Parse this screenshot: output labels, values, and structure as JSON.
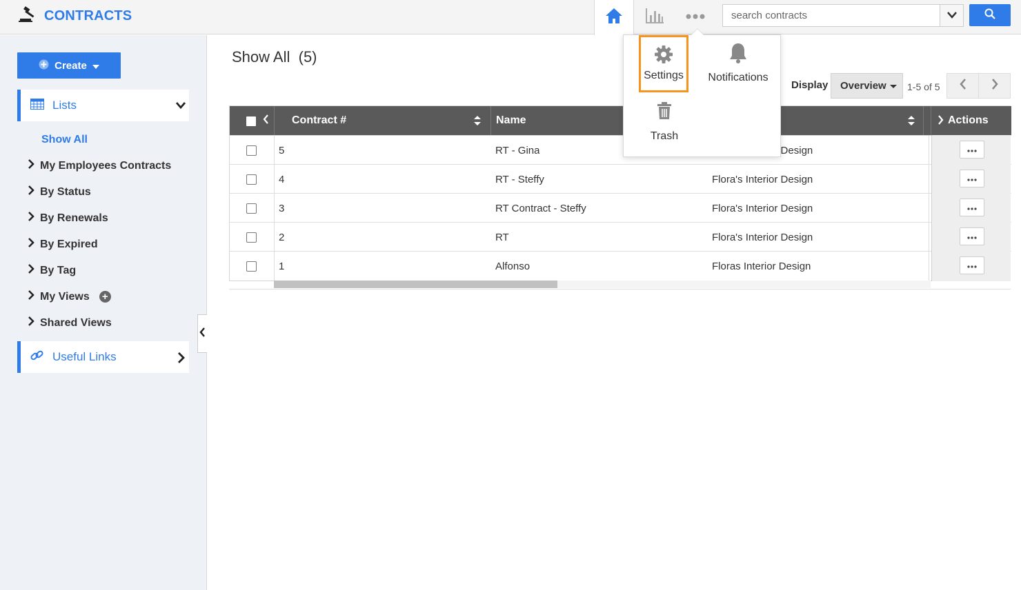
{
  "app": {
    "title": "CONTRACTS"
  },
  "topbar": {
    "icons": [
      "home-icon",
      "chart-icon",
      "more-dots-icon"
    ],
    "search": {
      "placeholder": "search contracts",
      "value": ""
    }
  },
  "sidebar": {
    "create_label": "Create",
    "lists_label": "Lists",
    "active_item": "Show All",
    "items": [
      {
        "label": "My Employees Contracts"
      },
      {
        "label": "By Status"
      },
      {
        "label": "By Renewals"
      },
      {
        "label": "By Expired"
      },
      {
        "label": "By Tag"
      },
      {
        "label": "My Views"
      },
      {
        "label": "Shared Views"
      }
    ],
    "useful_links_label": "Useful Links"
  },
  "main": {
    "title": "Show All",
    "count": "(5)",
    "display_label": "Display",
    "display_value": "Overview",
    "pager_text": "1-5 of 5"
  },
  "table": {
    "columns": [
      "Contract #",
      "Name",
      "Actions"
    ],
    "rows": [
      {
        "contract": "5",
        "name": "RT - Gina",
        "company": "Flora's Interior Design"
      },
      {
        "contract": "4",
        "name": "RT - Steffy",
        "company": "Flora's Interior Design"
      },
      {
        "contract": "3",
        "name": "RT Contract - Steffy",
        "company": "Flora's Interior Design"
      },
      {
        "contract": "2",
        "name": "RT",
        "company": "Flora's Interior Design"
      },
      {
        "contract": "1",
        "name": "Alfonso",
        "company": "Floras Interior Design"
      }
    ],
    "row1_company_visible": "Design"
  },
  "dropdown": {
    "settings_label": "Settings",
    "notifications_label": "Notifications",
    "trash_label": "Trash"
  },
  "colors": {
    "accent": "#2f7ce8",
    "highlight": "#f7941d",
    "table_header": "#5a5a5a"
  }
}
